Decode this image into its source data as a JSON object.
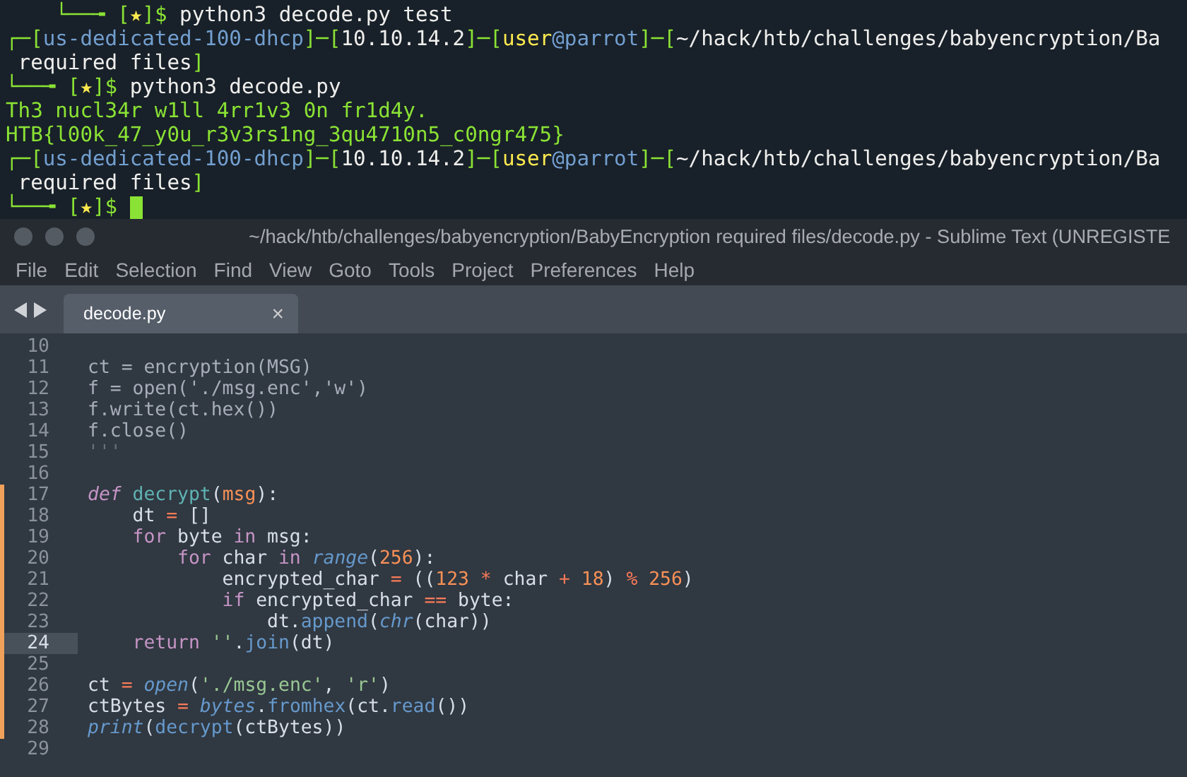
{
  "terminal": {
    "lines": [
      {
        "cursor": false,
        "tokens": [
          {
            "kind": "frame",
            "text": "    └──╼ ["
          },
          {
            "kind": "star",
            "text": "★"
          },
          {
            "kind": "frame",
            "text": "]$"
          },
          {
            "kind": "plain",
            "text": " python3 decode.py test"
          }
        ]
      },
      {
        "cursor": false,
        "tokens": [
          {
            "kind": "frame",
            "text": "┌─["
          },
          {
            "kind": "host",
            "text": "us-dedicated-100-dhcp"
          },
          {
            "kind": "frame",
            "text": "]─["
          },
          {
            "kind": "plain",
            "text": "10.10.14.2"
          },
          {
            "kind": "frame",
            "text": "]─["
          },
          {
            "kind": "user",
            "text": "user"
          },
          {
            "kind": "host",
            "text": "@parrot"
          },
          {
            "kind": "frame",
            "text": "]─["
          },
          {
            "kind": "plain",
            "text": "~/hack/htb/challenges/babyencryption/Ba"
          }
        ]
      },
      {
        "cursor": false,
        "tokens": [
          {
            "kind": "plain",
            "text": " required files"
          },
          {
            "kind": "frame",
            "text": "]"
          }
        ]
      },
      {
        "cursor": false,
        "tokens": [
          {
            "kind": "frame",
            "text": "└──╼ ["
          },
          {
            "kind": "star",
            "text": "★"
          },
          {
            "kind": "frame",
            "text": "]$"
          },
          {
            "kind": "plain",
            "text": " python3 decode.py"
          }
        ]
      },
      {
        "cursor": false,
        "tokens": [
          {
            "kind": "output",
            "text": "Th3 nucl34r w1ll 4rr1v3 0n fr1d4y."
          }
        ]
      },
      {
        "cursor": false,
        "tokens": [
          {
            "kind": "output",
            "text": "HTB{l00k_47_y0u_r3v3rs1ng_3qu4710n5_c0ngr475}"
          }
        ]
      },
      {
        "cursor": false,
        "tokens": [
          {
            "kind": "frame",
            "text": "┌─["
          },
          {
            "kind": "host",
            "text": "us-dedicated-100-dhcp"
          },
          {
            "kind": "frame",
            "text": "]─["
          },
          {
            "kind": "plain",
            "text": "10.10.14.2"
          },
          {
            "kind": "frame",
            "text": "]─["
          },
          {
            "kind": "user",
            "text": "user"
          },
          {
            "kind": "host",
            "text": "@parrot"
          },
          {
            "kind": "frame",
            "text": "]─["
          },
          {
            "kind": "plain",
            "text": "~/hack/htb/challenges/babyencryption/Ba"
          }
        ]
      },
      {
        "cursor": false,
        "tokens": [
          {
            "kind": "plain",
            "text": " required files"
          },
          {
            "kind": "frame",
            "text": "]"
          }
        ]
      },
      {
        "cursor": true,
        "tokens": [
          {
            "kind": "frame",
            "text": "└──╼ ["
          },
          {
            "kind": "star",
            "text": "★"
          },
          {
            "kind": "frame",
            "text": "]$"
          }
        ]
      }
    ]
  },
  "editor": {
    "title": "~/hack/htb/challenges/babyencryption/BabyEncryption required files/decode.py - Sublime Text (UNREGISTE",
    "menu": [
      "File",
      "Edit",
      "Selection",
      "Find",
      "View",
      "Goto",
      "Tools",
      "Project",
      "Preferences",
      "Help"
    ],
    "tabs": [
      {
        "label": "decode.py",
        "close": "×",
        "selected": true
      }
    ],
    "lines": [
      {
        "number": "10",
        "modified": false,
        "current": false
      },
      {
        "number": "11",
        "modified": false,
        "current": false,
        "tokens": [
          {
            "kind": "doc",
            "text": "ct = encryption(MSG)"
          }
        ]
      },
      {
        "number": "12",
        "modified": false,
        "current": false,
        "tokens": [
          {
            "kind": "doc",
            "text": "f = open('./msg.enc','w')"
          }
        ]
      },
      {
        "number": "13",
        "modified": false,
        "current": false,
        "tokens": [
          {
            "kind": "doc",
            "text": "f.write(ct.hex())"
          }
        ]
      },
      {
        "number": "14",
        "modified": false,
        "current": false,
        "tokens": [
          {
            "kind": "doc",
            "text": "f.close()"
          }
        ]
      },
      {
        "number": "15",
        "modified": false,
        "current": false,
        "tokens": [
          {
            "kind": "comment",
            "text": "'''"
          }
        ]
      },
      {
        "number": "16",
        "modified": false,
        "current": false
      },
      {
        "number": "17",
        "modified": true,
        "current": false,
        "tokens": [
          {
            "kind": "storage",
            "text": "def"
          },
          {
            "kind": "entity",
            "text": " decrypt"
          },
          {
            "kind": "plain",
            "text": "("
          },
          {
            "kind": "param",
            "text": "msg"
          },
          {
            "kind": "plain",
            "text": "):"
          }
        ]
      },
      {
        "number": "18",
        "modified": true,
        "current": false,
        "tokens": [
          {
            "kind": "plain",
            "text": "    dt "
          },
          {
            "kind": "operator",
            "text": "="
          },
          {
            "kind": "plain",
            "text": " []"
          }
        ]
      },
      {
        "number": "19",
        "modified": true,
        "current": false,
        "tokens": [
          {
            "kind": "keyword",
            "text": "    for"
          },
          {
            "kind": "plain",
            "text": " byte "
          },
          {
            "kind": "keyword",
            "text": "in"
          },
          {
            "kind": "plain",
            "text": " msg:"
          }
        ]
      },
      {
        "number": "20",
        "modified": true,
        "current": false,
        "tokens": [
          {
            "kind": "keyword",
            "text": "        for"
          },
          {
            "kind": "plain",
            "text": " char "
          },
          {
            "kind": "keyword",
            "text": "in"
          },
          {
            "kind": "builtin",
            "text": " range"
          },
          {
            "kind": "plain",
            "text": "("
          },
          {
            "kind": "number",
            "text": "256"
          },
          {
            "kind": "plain",
            "text": "):"
          }
        ]
      },
      {
        "number": "21",
        "modified": true,
        "current": false,
        "tokens": [
          {
            "kind": "plain",
            "text": "            encrypted_char "
          },
          {
            "kind": "operator",
            "text": "="
          },
          {
            "kind": "plain",
            "text": " (("
          },
          {
            "kind": "number",
            "text": "123"
          },
          {
            "kind": "operator",
            "text": " *"
          },
          {
            "kind": "plain",
            "text": " char "
          },
          {
            "kind": "operator",
            "text": "+"
          },
          {
            "kind": "number",
            "text": " 18"
          },
          {
            "kind": "plain",
            "text": ") "
          },
          {
            "kind": "operator",
            "text": "%"
          },
          {
            "kind": "number",
            "text": " 256"
          },
          {
            "kind": "plain",
            "text": ")"
          }
        ]
      },
      {
        "number": "22",
        "modified": true,
        "current": false,
        "tokens": [
          {
            "kind": "keyword",
            "text": "            if"
          },
          {
            "kind": "plain",
            "text": " encrypted_char "
          },
          {
            "kind": "operator",
            "text": "=="
          },
          {
            "kind": "plain",
            "text": " byte:"
          }
        ]
      },
      {
        "number": "23",
        "modified": true,
        "current": false,
        "tokens": [
          {
            "kind": "plain",
            "text": "                dt."
          },
          {
            "kind": "method",
            "text": "append"
          },
          {
            "kind": "plain",
            "text": "("
          },
          {
            "kind": "builtin",
            "text": "chr"
          },
          {
            "kind": "plain",
            "text": "(char))"
          }
        ]
      },
      {
        "number": "24",
        "modified": true,
        "current": true,
        "tokens": [
          {
            "kind": "keyword",
            "text": "    return"
          },
          {
            "kind": "string",
            "text": " ''"
          },
          {
            "kind": "plain",
            "text": "."
          },
          {
            "kind": "method",
            "text": "join"
          },
          {
            "kind": "plain",
            "text": "(dt)"
          }
        ]
      },
      {
        "number": "25",
        "modified": true,
        "current": false
      },
      {
        "number": "26",
        "modified": true,
        "current": false,
        "tokens": [
          {
            "kind": "plain",
            "text": "ct "
          },
          {
            "kind": "operator",
            "text": "="
          },
          {
            "kind": "builtin",
            "text": " open"
          },
          {
            "kind": "plain",
            "text": "("
          },
          {
            "kind": "string",
            "text": "'./msg.enc'"
          },
          {
            "kind": "plain",
            "text": ","
          },
          {
            "kind": "string",
            "text": " 'r'"
          },
          {
            "kind": "plain",
            "text": ")"
          }
        ]
      },
      {
        "number": "27",
        "modified": true,
        "current": false,
        "tokens": [
          {
            "kind": "plain",
            "text": "ctBytes "
          },
          {
            "kind": "operator",
            "text": "="
          },
          {
            "kind": "builtin",
            "text": " bytes"
          },
          {
            "kind": "plain",
            "text": "."
          },
          {
            "kind": "method",
            "text": "fromhex"
          },
          {
            "kind": "plain",
            "text": "(ct."
          },
          {
            "kind": "method",
            "text": "read"
          },
          {
            "kind": "plain",
            "text": "())"
          }
        ]
      },
      {
        "number": "28",
        "modified": true,
        "current": false,
        "tokens": [
          {
            "kind": "builtin",
            "text": "print"
          },
          {
            "kind": "plain",
            "text": "("
          },
          {
            "kind": "method",
            "text": "decrypt"
          },
          {
            "kind": "plain",
            "text": "(ctBytes))"
          }
        ]
      },
      {
        "number": "29",
        "modified": false,
        "current": false
      }
    ]
  }
}
